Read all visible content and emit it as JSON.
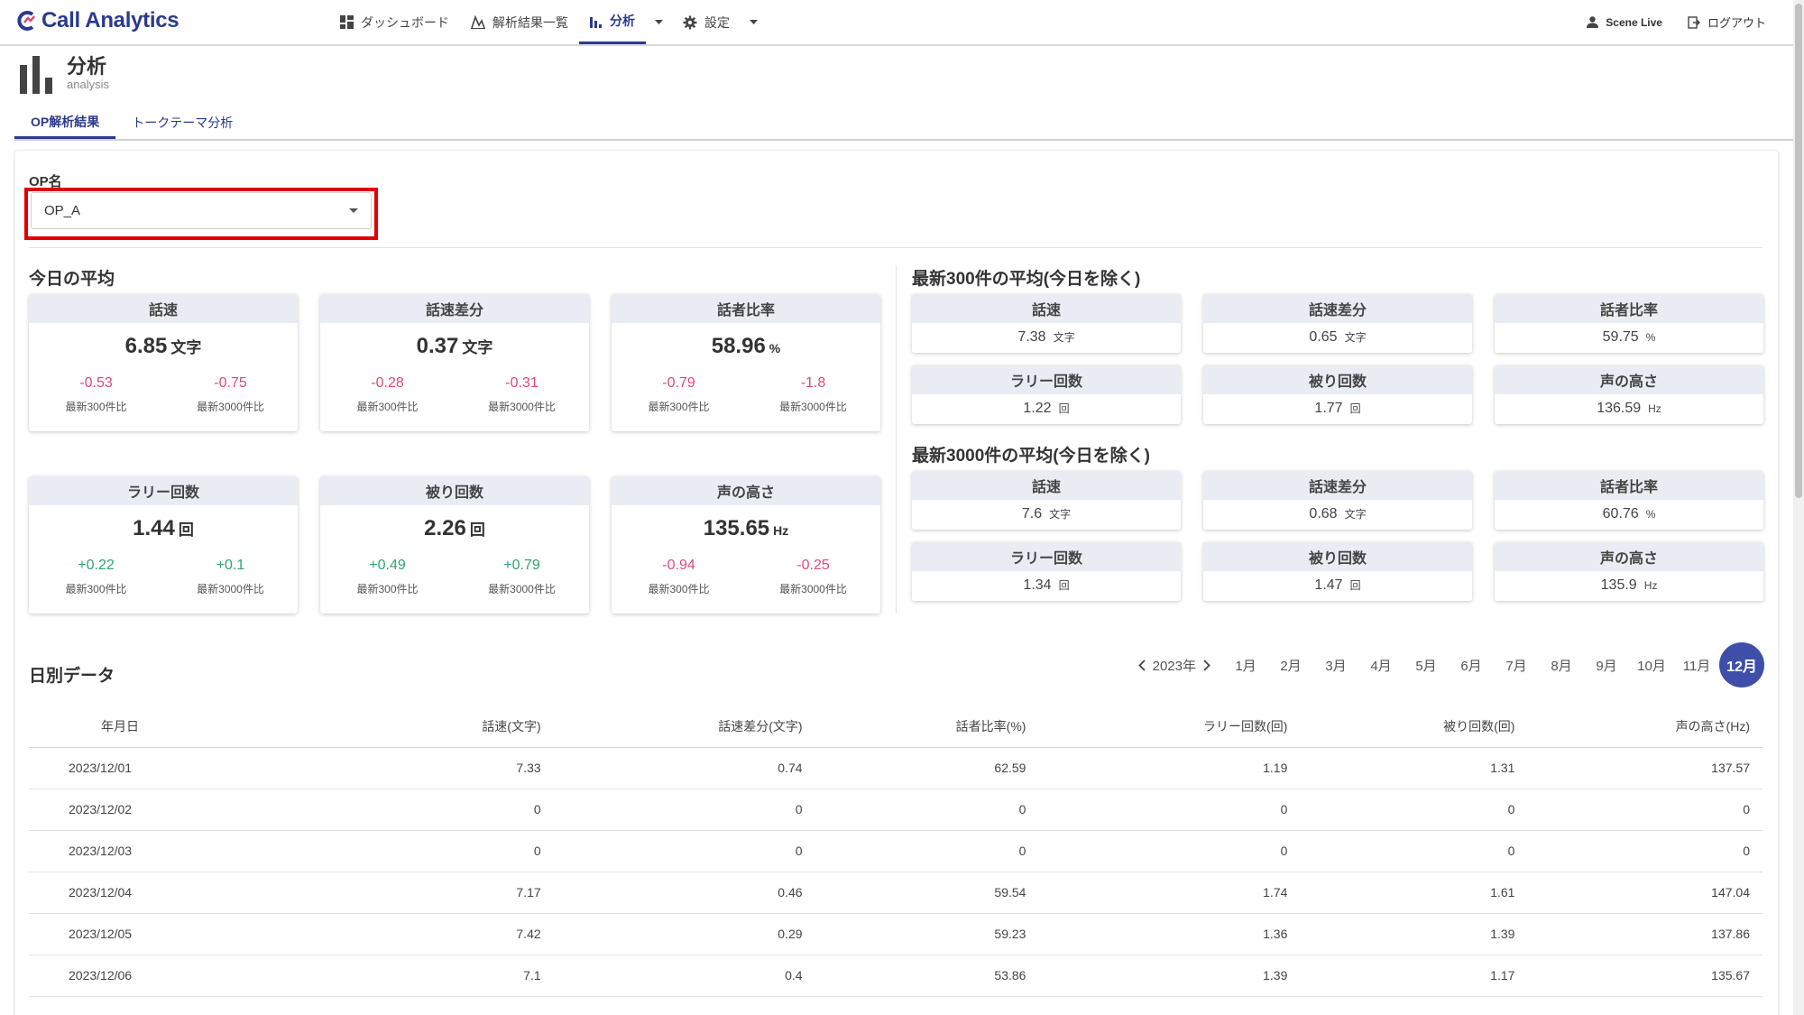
{
  "app": {
    "title": "Call Analytics"
  },
  "nav": {
    "items": [
      {
        "label": "ダッシュボード",
        "icon": "dashboard-icon"
      },
      {
        "label": "解析結果一覧",
        "icon": "chart-line-icon"
      },
      {
        "label": "分析",
        "icon": "bar-chart-icon"
      },
      {
        "label": "設定",
        "icon": "gear-icon"
      }
    ],
    "user": "Scene Live",
    "logout": "ログアウト"
  },
  "page": {
    "title": "分析",
    "subtitle": "analysis"
  },
  "tabs": [
    "OP解析結果",
    "トークテーマ分析"
  ],
  "op": {
    "label": "OP名",
    "value": "OP_A"
  },
  "today": {
    "title": "今日の平均",
    "cmp1": "最新300件比",
    "cmp2": "最新3000件比",
    "stats": [
      {
        "label": "話速",
        "value": "6.85",
        "unit": "文字",
        "d1": "-0.53",
        "d2": "-0.75"
      },
      {
        "label": "話速差分",
        "value": "0.37",
        "unit": "文字",
        "d1": "-0.28",
        "d2": "-0.31"
      },
      {
        "label": "話者比率",
        "value": "58.96",
        "unit": "%",
        "d1": "-0.79",
        "d2": "-1.8"
      },
      {
        "label": "ラリー回数",
        "value": "1.44",
        "unit": "回",
        "d1": "+0.22",
        "d2": "+0.1"
      },
      {
        "label": "被り回数",
        "value": "2.26",
        "unit": "回",
        "d1": "+0.49",
        "d2": "+0.79"
      },
      {
        "label": "声の高さ",
        "value": "135.65",
        "unit": "Hz",
        "d1": "-0.94",
        "d2": "-0.25"
      }
    ]
  },
  "latest300": {
    "title": "最新300件の平均(今日を除く)",
    "stats": [
      {
        "label": "話速",
        "value": "7.38",
        "unit": "文字"
      },
      {
        "label": "話速差分",
        "value": "0.65",
        "unit": "文字"
      },
      {
        "label": "話者比率",
        "value": "59.75",
        "unit": "%"
      },
      {
        "label": "ラリー回数",
        "value": "1.22",
        "unit": "回"
      },
      {
        "label": "被り回数",
        "value": "1.77",
        "unit": "回"
      },
      {
        "label": "声の高さ",
        "value": "136.59",
        "unit": "Hz"
      }
    ]
  },
  "latest3000": {
    "title": "最新3000件の平均(今日を除く)",
    "stats": [
      {
        "label": "話速",
        "value": "7.6",
        "unit": "文字"
      },
      {
        "label": "話速差分",
        "value": "0.68",
        "unit": "文字"
      },
      {
        "label": "話者比率",
        "value": "60.76",
        "unit": "%"
      },
      {
        "label": "ラリー回数",
        "value": "1.34",
        "unit": "回"
      },
      {
        "label": "被り回数",
        "value": "1.47",
        "unit": "回"
      },
      {
        "label": "声の高さ",
        "value": "135.9",
        "unit": "Hz"
      }
    ]
  },
  "daily": {
    "title": "日別データ",
    "year": "2023年",
    "months": [
      "1月",
      "2月",
      "3月",
      "4月",
      "5月",
      "6月",
      "7月",
      "8月",
      "9月",
      "10月",
      "11月",
      "12月"
    ],
    "selected_month": "12月",
    "columns": [
      "年月日",
      "話速(文字)",
      "話速差分(文字)",
      "話者比率(%)",
      "ラリー回数(回)",
      "被り回数(回)",
      "声の高さ(Hz)"
    ],
    "rows": [
      [
        "2023/12/01",
        "7.33",
        "0.74",
        "62.59",
        "1.19",
        "1.31",
        "137.57"
      ],
      [
        "2023/12/02",
        "0",
        "0",
        "0",
        "0",
        "0",
        "0"
      ],
      [
        "2023/12/03",
        "0",
        "0",
        "0",
        "0",
        "0",
        "0"
      ],
      [
        "2023/12/04",
        "7.17",
        "0.46",
        "59.54",
        "1.74",
        "1.61",
        "147.04"
      ],
      [
        "2023/12/05",
        "7.42",
        "0.29",
        "59.23",
        "1.36",
        "1.39",
        "137.86"
      ],
      [
        "2023/12/06",
        "7.1",
        "0.4",
        "53.86",
        "1.39",
        "1.17",
        "135.67"
      ]
    ]
  },
  "colors": {
    "accent": "#2b3a8f",
    "negative": "#e04a77",
    "positive": "#2ea56b",
    "highlight": "#e00000"
  }
}
